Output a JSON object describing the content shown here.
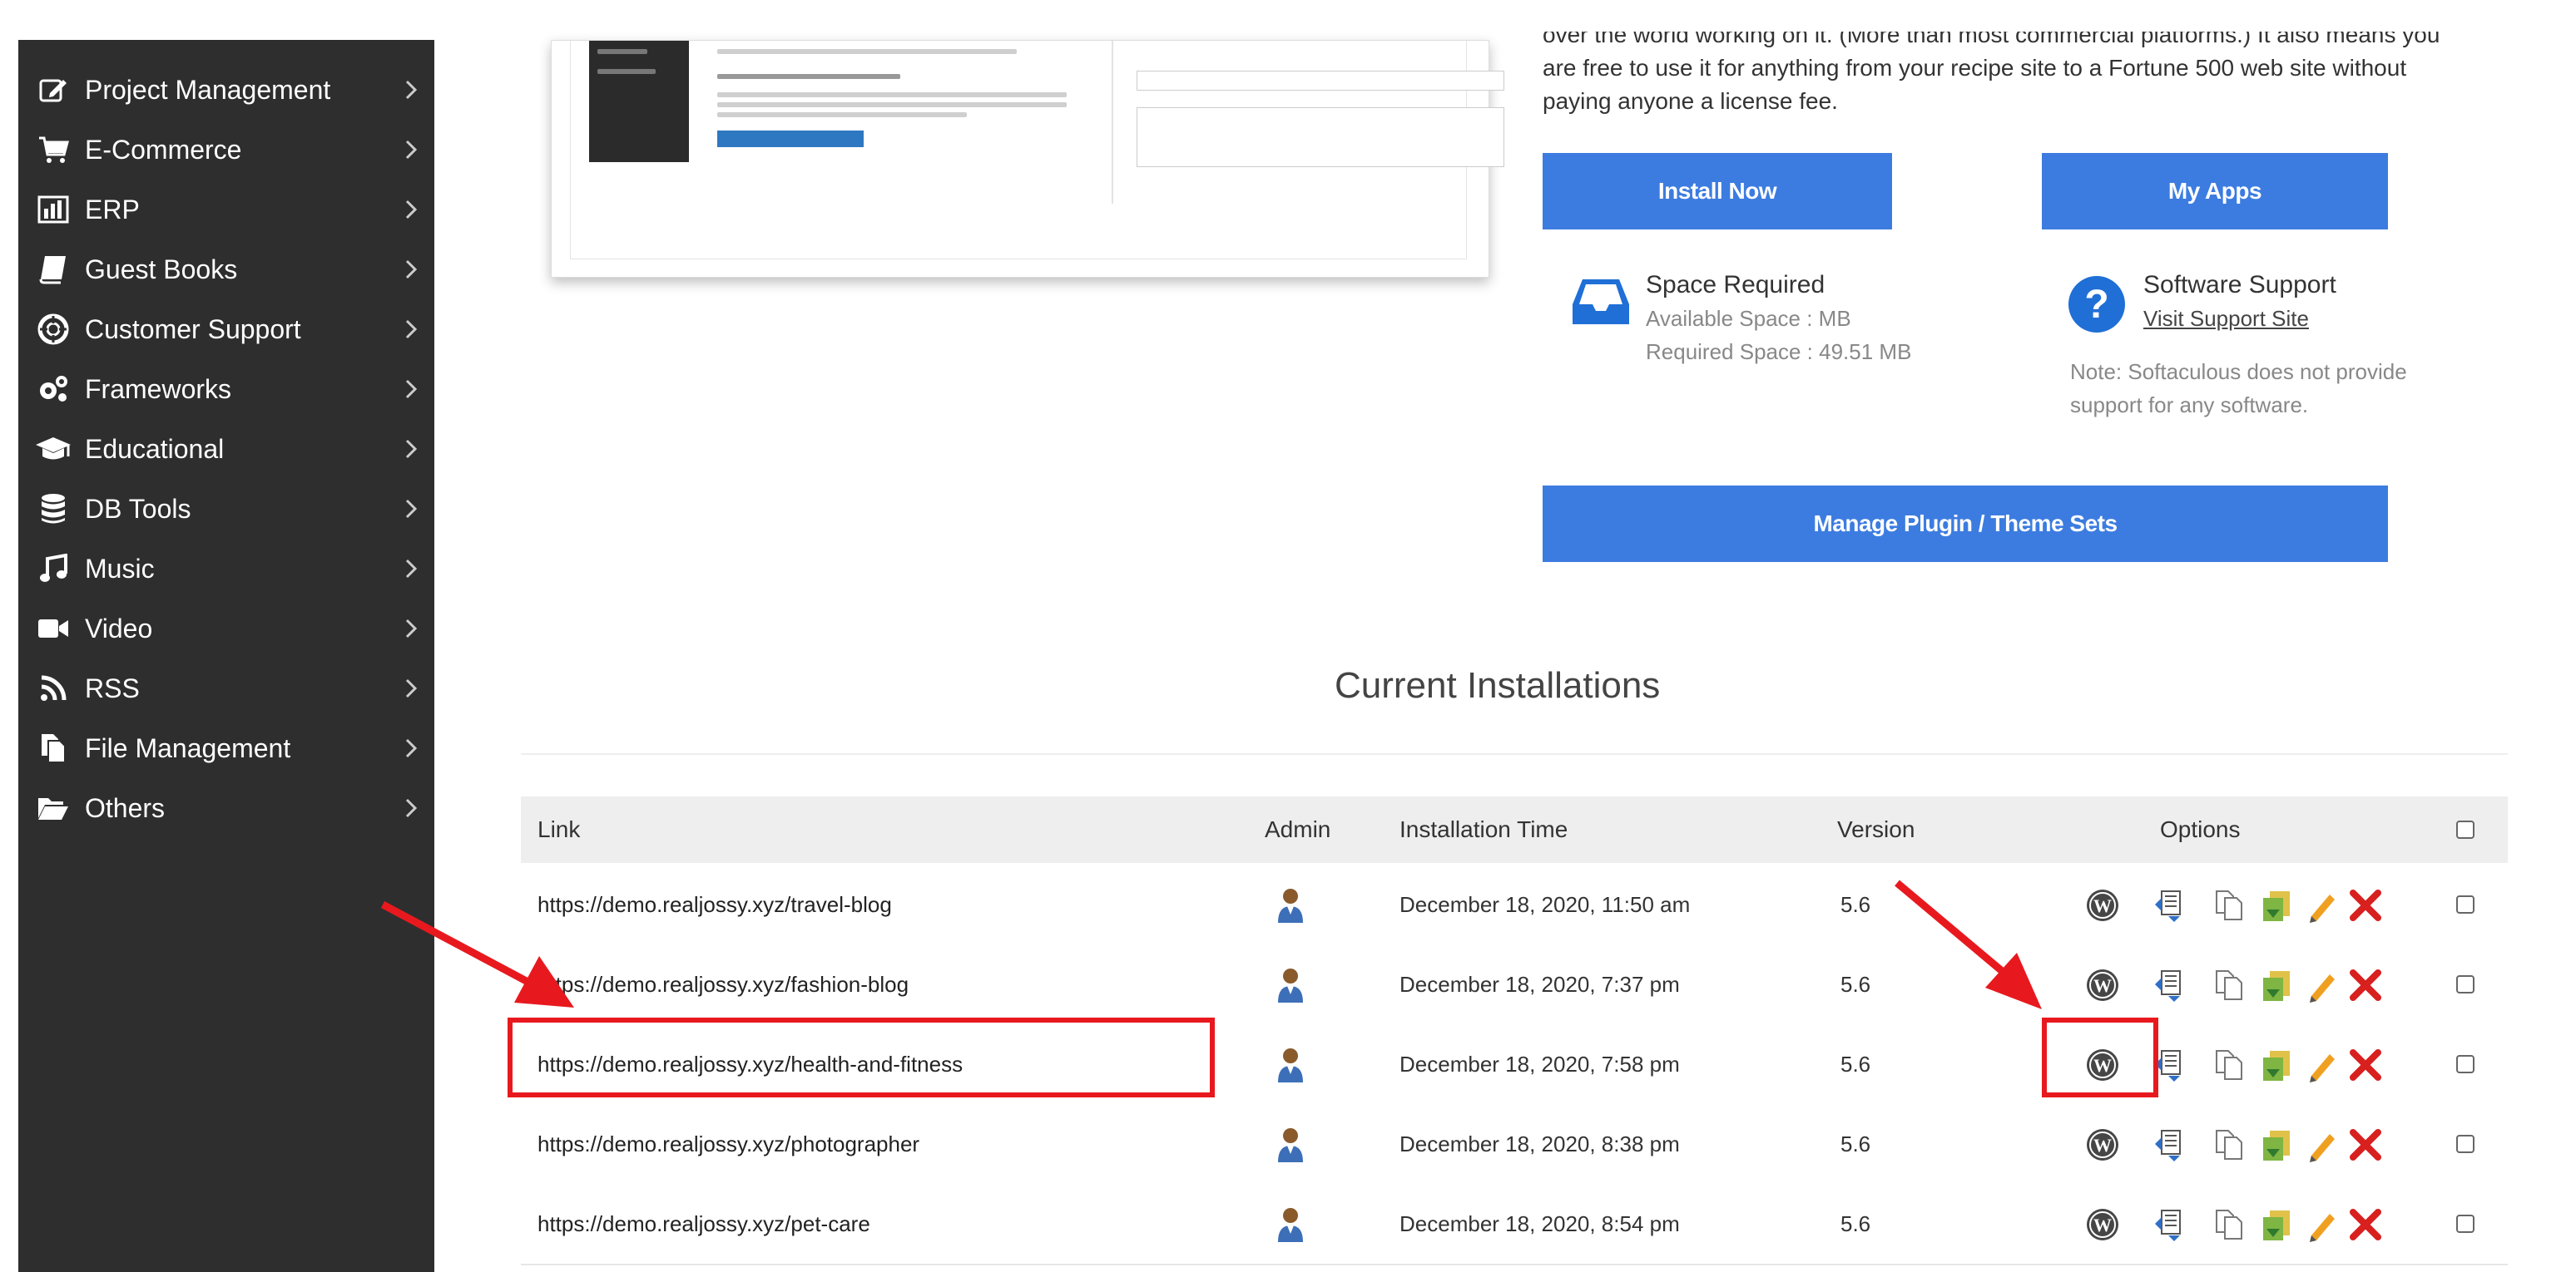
{
  "sidebar": {
    "items": [
      {
        "label": "Project Management",
        "icon": "pencil-square-icon"
      },
      {
        "label": "E-Commerce",
        "icon": "cart-icon"
      },
      {
        "label": "ERP",
        "icon": "bar-chart-icon"
      },
      {
        "label": "Guest Books",
        "icon": "book-icon"
      },
      {
        "label": "Customer Support",
        "icon": "lifebuoy-icon"
      },
      {
        "label": "Frameworks",
        "icon": "gears-icon"
      },
      {
        "label": "Educational",
        "icon": "graduation-cap-icon"
      },
      {
        "label": "DB Tools",
        "icon": "database-icon"
      },
      {
        "label": "Music",
        "icon": "music-icon"
      },
      {
        "label": "Video",
        "icon": "video-camera-icon"
      },
      {
        "label": "RSS",
        "icon": "rss-icon"
      },
      {
        "label": "File Management",
        "icon": "files-icon"
      },
      {
        "label": "Others",
        "icon": "folder-open-icon"
      }
    ]
  },
  "description": {
    "line1": "over the world working on it. (More than most commercial platforms.) It also means you",
    "line2": "are free to use it for anything from your recipe site to a Fortune 500 web site without",
    "line3": "paying anyone a license fee."
  },
  "buttons": {
    "install_now": "Install Now",
    "my_apps": "My Apps",
    "manage_sets": "Manage Plugin / Theme Sets"
  },
  "space": {
    "title": "Space Required",
    "available": "Available Space : MB",
    "required": "Required Space : 49.51 MB"
  },
  "support": {
    "title": "Software Support",
    "link": "Visit Support Site",
    "note_line1": "Note: Softaculous does not provide",
    "note_line2": "support for any software."
  },
  "installations": {
    "title": "Current Installations",
    "headers": {
      "link": "Link",
      "admin": "Admin",
      "time": "Installation Time",
      "version": "Version",
      "options": "Options"
    },
    "rows": [
      {
        "link": "https://demo.realjossy.xyz/travel-blog",
        "time": "December 18, 2020, 11:50 am",
        "version": "5.6"
      },
      {
        "link": "https://demo.realjossy.xyz/fashion-blog",
        "time": "December 18, 2020, 7:37 pm",
        "version": "5.6"
      },
      {
        "link": "https://demo.realjossy.xyz/health-and-fitness",
        "time": "December 18, 2020, 7:58 pm",
        "version": "5.6"
      },
      {
        "link": "https://demo.realjossy.xyz/photographer",
        "time": "December 18, 2020, 8:38 pm",
        "version": "5.6"
      },
      {
        "link": "https://demo.realjossy.xyz/pet-care",
        "time": "December 18, 2020, 8:54 pm",
        "version": "5.6"
      }
    ]
  },
  "colors": {
    "sidebar_bg": "#2e2e2e",
    "button_blue": "#3c7ce0",
    "highlight_red": "#e8191e"
  }
}
